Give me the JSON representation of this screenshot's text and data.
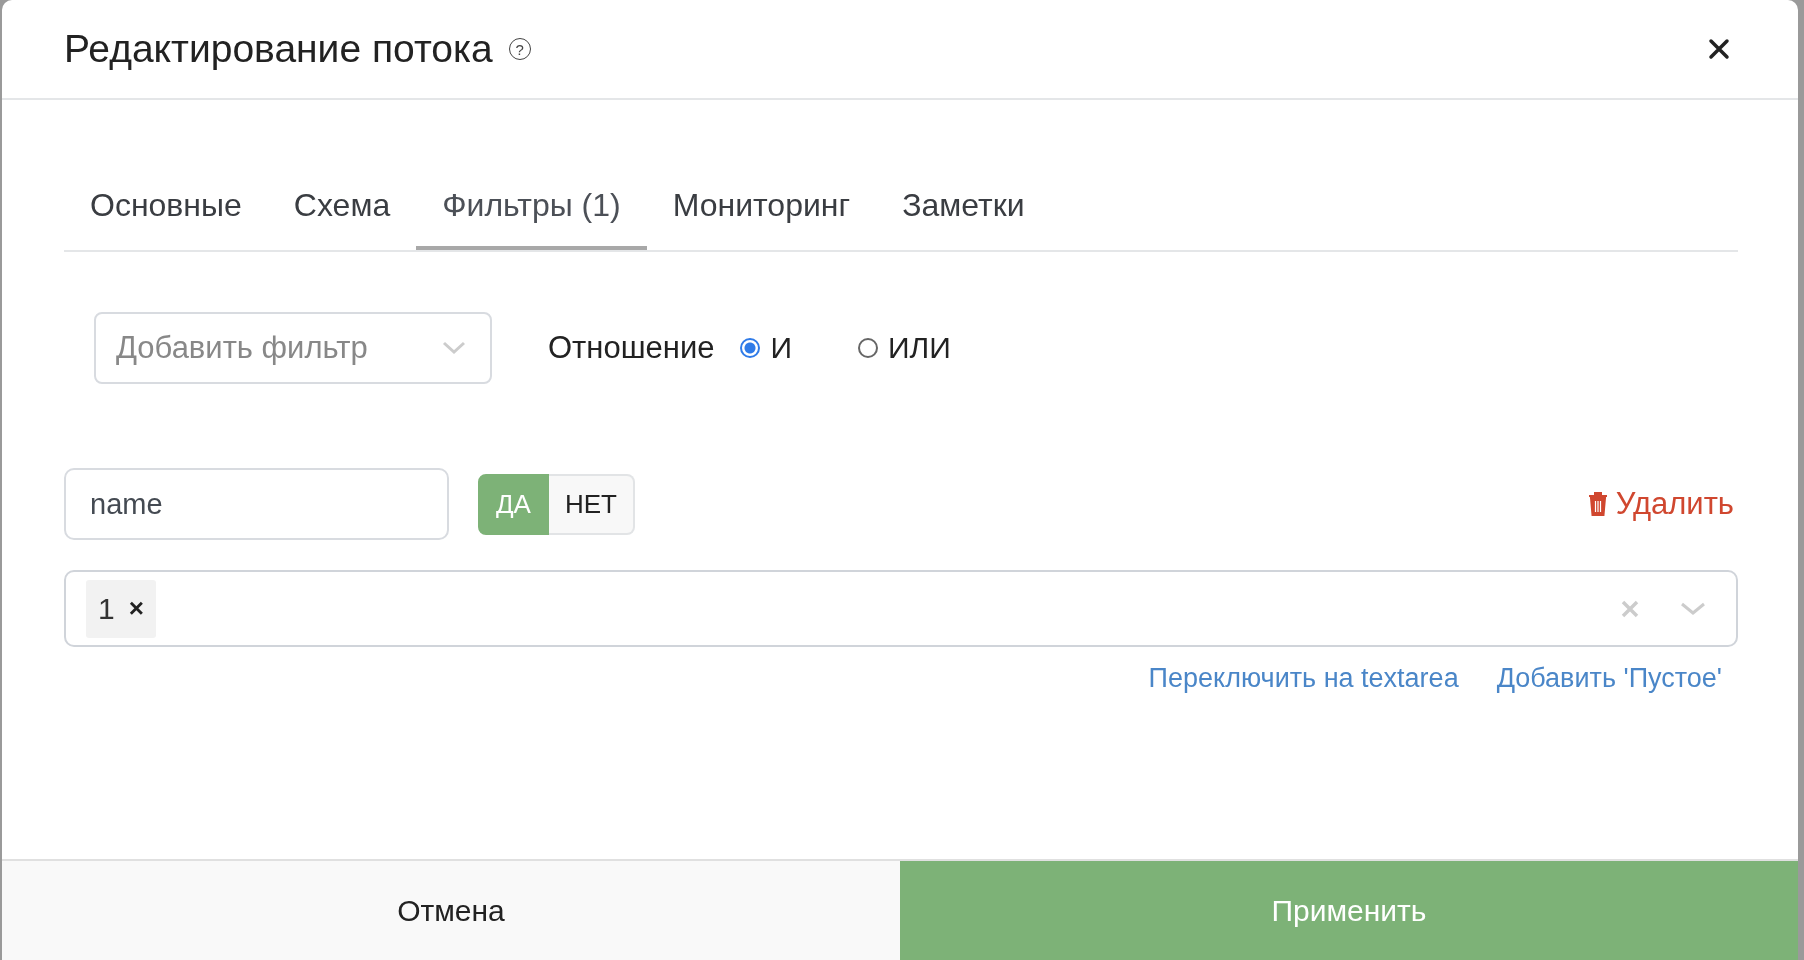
{
  "dialog": {
    "title": "Редактирование потока",
    "help_glyph": "?"
  },
  "tabs": [
    {
      "label": "Основные",
      "selected": false
    },
    {
      "label": "Схема",
      "selected": false
    },
    {
      "label": "Фильтры (1)",
      "selected": true
    },
    {
      "label": "Мониторинг",
      "selected": false
    },
    {
      "label": "Заметки",
      "selected": false
    }
  ],
  "add_filter": {
    "placeholder": "Добавить фильтр"
  },
  "relation": {
    "label": "Отношение",
    "options": [
      {
        "label": "И",
        "selected": true
      },
      {
        "label": "ИЛИ",
        "selected": false
      }
    ]
  },
  "filter": {
    "field": "name",
    "toggle": [
      {
        "label": "ДА",
        "selected": true
      },
      {
        "label": "НЕТ",
        "selected": false
      }
    ],
    "delete_label": "Удалить",
    "values": [
      {
        "label": "1",
        "remove": "×"
      }
    ],
    "links": [
      "Переключить на textarea",
      "Добавить 'Пустое'"
    ]
  },
  "footer": {
    "cancel": "Отмена",
    "apply": "Применить"
  }
}
